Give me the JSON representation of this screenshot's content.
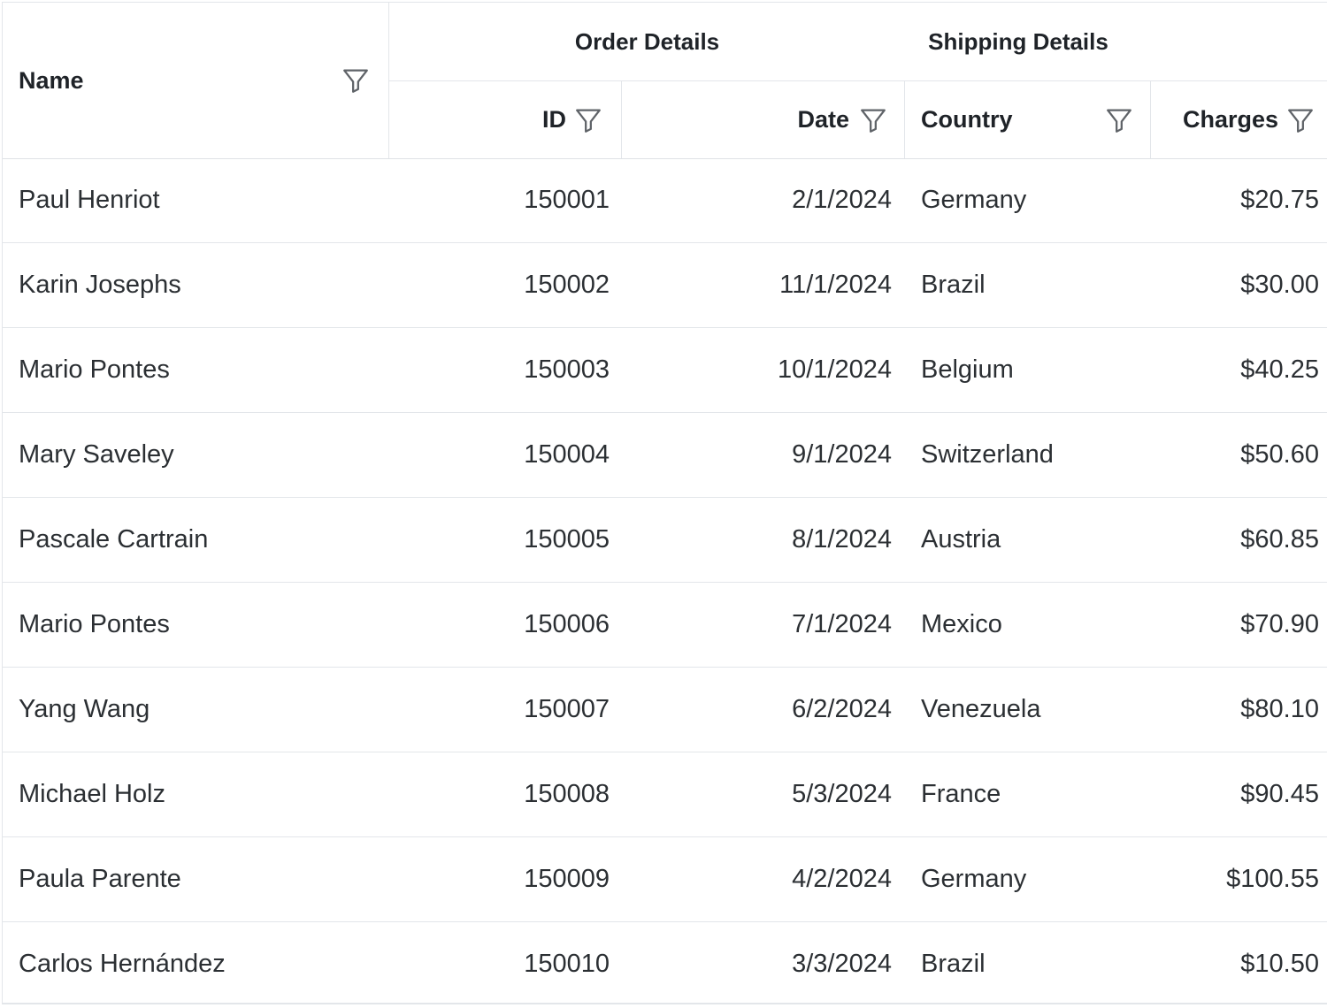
{
  "header": {
    "name_label": "Name",
    "order_group_label": "Order Details",
    "shipping_group_label": "Shipping Details",
    "id_label": "ID",
    "date_label": "Date",
    "country_label": "Country",
    "charges_label": "Charges"
  },
  "rows": [
    {
      "name": "Paul Henriot",
      "id": "150001",
      "date": "2/1/2024",
      "country": "Germany",
      "charges": "$20.75"
    },
    {
      "name": "Karin Josephs",
      "id": "150002",
      "date": "11/1/2024",
      "country": "Brazil",
      "charges": "$30.00"
    },
    {
      "name": "Mario Pontes",
      "id": "150003",
      "date": "10/1/2024",
      "country": "Belgium",
      "charges": "$40.25"
    },
    {
      "name": "Mary Saveley",
      "id": "150004",
      "date": "9/1/2024",
      "country": "Switzerland",
      "charges": "$50.60"
    },
    {
      "name": "Pascale Cartrain",
      "id": "150005",
      "date": "8/1/2024",
      "country": "Austria",
      "charges": "$60.85"
    },
    {
      "name": "Mario Pontes",
      "id": "150006",
      "date": "7/1/2024",
      "country": "Mexico",
      "charges": "$70.90"
    },
    {
      "name": "Yang Wang",
      "id": "150007",
      "date": "6/2/2024",
      "country": "Venezuela",
      "charges": "$80.10"
    },
    {
      "name": "Michael Holz",
      "id": "150008",
      "date": "5/3/2024",
      "country": "France",
      "charges": "$90.45"
    },
    {
      "name": "Paula Parente",
      "id": "150009",
      "date": "4/2/2024",
      "country": "Germany",
      "charges": "$100.55"
    },
    {
      "name": "Carlos Hernández",
      "id": "150010",
      "date": "3/3/2024",
      "country": "Brazil",
      "charges": "$10.50"
    }
  ],
  "icons": {
    "filter": "filter-icon"
  }
}
